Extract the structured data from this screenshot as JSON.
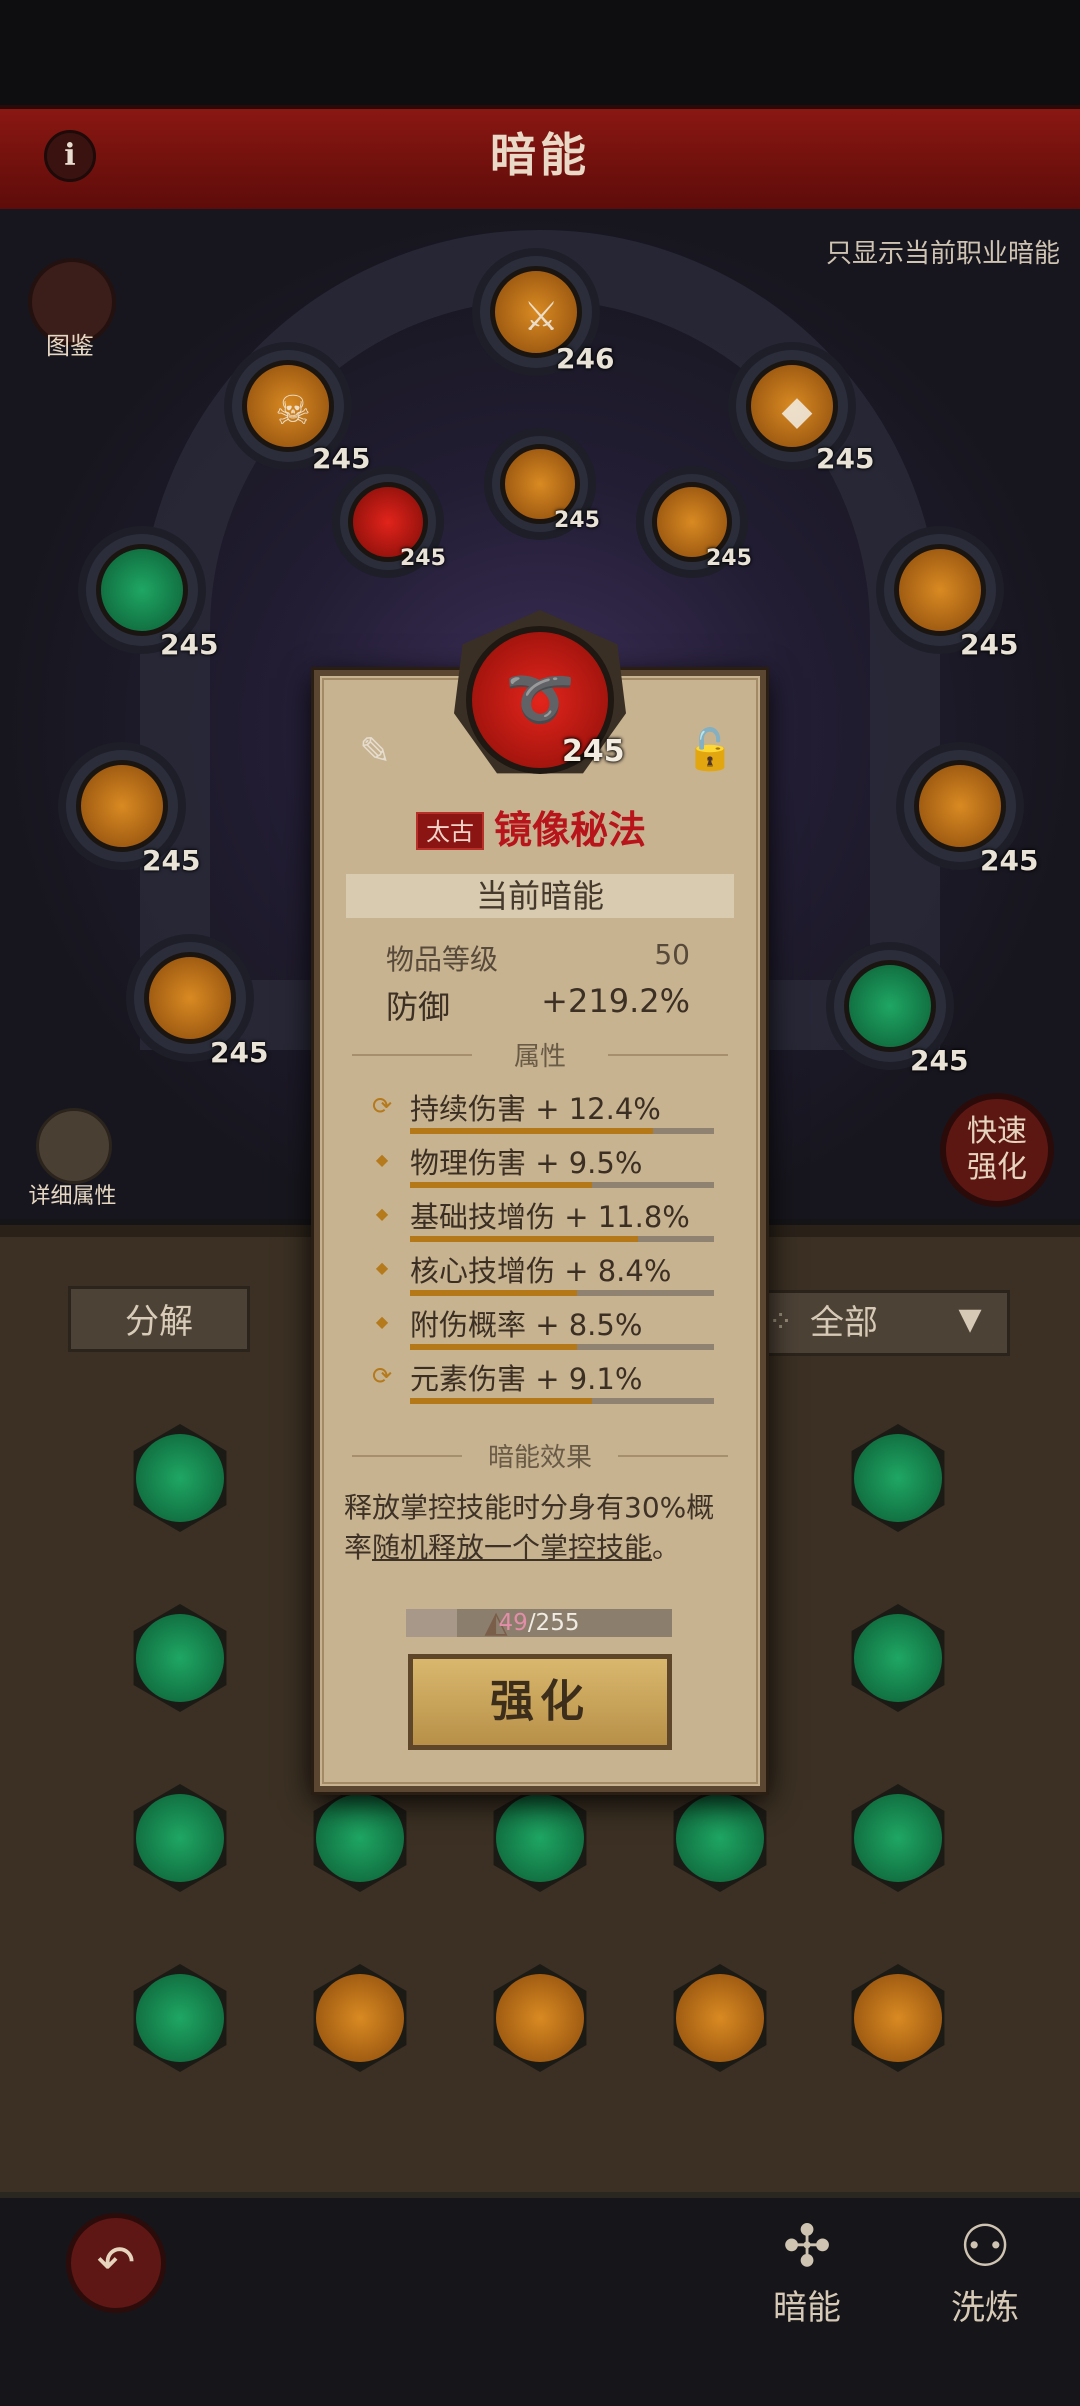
{
  "header": {
    "title": "暗能",
    "info_icon": "info-icon"
  },
  "top": {
    "only_current_label": "只显示当前职业暗能",
    "codex_label": "图鉴",
    "detail_label": "详细属性",
    "quick_label_1": "快速",
    "quick_label_2": "强化"
  },
  "slots": [
    {
      "level": "246",
      "color": "orange"
    },
    {
      "level": "245",
      "color": "orange"
    },
    {
      "level": "245",
      "color": "orange"
    },
    {
      "level": "245",
      "color": "red"
    },
    {
      "level": "245",
      "color": "orange"
    },
    {
      "level": "245",
      "color": "orange"
    },
    {
      "level": "245",
      "color": "green"
    },
    {
      "level": "245",
      "color": "orange"
    },
    {
      "level": "245",
      "color": "orange"
    },
    {
      "level": "245",
      "color": "orange"
    },
    {
      "level": "245",
      "color": "orange"
    },
    {
      "level": "245",
      "color": "green"
    }
  ],
  "toolbar": {
    "decompose_label": "分解",
    "filter_label": "全部"
  },
  "popup": {
    "level": "245",
    "rarity": "太古",
    "name": "镜像秘法",
    "current_title": "当前暗能",
    "item_level_label": "物品等级",
    "item_level_value": "50",
    "defense_label": "防御",
    "defense_value": "+219.2%",
    "attr_title": "属性",
    "attributes": [
      {
        "text": "持续伤害 + 12.4%",
        "icon": "refresh-icon",
        "fill": 0.8
      },
      {
        "text": "物理伤害 + 9.5%",
        "icon": "diamond-icon",
        "fill": 0.6
      },
      {
        "text": "基础技增伤 + 11.8%",
        "icon": "diamond-icon",
        "fill": 0.75
      },
      {
        "text": "核心技增伤 + 8.4%",
        "icon": "diamond-icon",
        "fill": 0.55
      },
      {
        "text": "附伤概率 + 8.5%",
        "icon": "diamond-icon",
        "fill": 0.55
      },
      {
        "text": "元素伤害 + 9.1%",
        "icon": "refresh-icon",
        "fill": 0.6
      }
    ],
    "effect_title": "暗能效果",
    "effect_text_1": "释放掌控技能时分身有30%概率",
    "effect_link": "随机释放一个掌控技能",
    "effect_text_2": "。",
    "progress_current": "49",
    "progress_total": "/255",
    "progress_fraction": 0.19,
    "enhance_label": "强化"
  },
  "nav": {
    "anneng": "暗能",
    "xilian": "洗炼"
  },
  "colors": {
    "accent_red": "#8a1712",
    "parchment": "#c8b391",
    "gold": "#b57818"
  }
}
